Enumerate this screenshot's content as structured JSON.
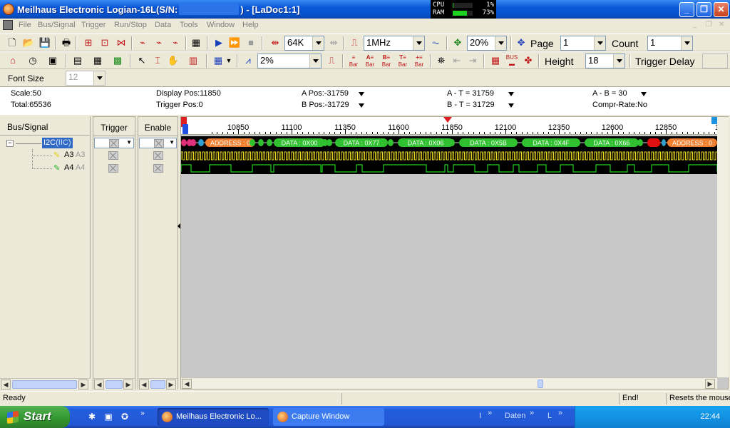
{
  "window": {
    "title_prefix": "Meilhaus Electronic Logian-16L(S/N:",
    "title_suffix": ") - [LaDoc1:1]"
  },
  "cpu_monitor": {
    "cpu_label": "CPU",
    "cpu_value": "1%",
    "cpu_fraction": 0.01,
    "ram_label": "RAM",
    "ram_value": "73%",
    "ram_fraction": 0.73
  },
  "menu": [
    "File",
    "Bus/Signal",
    "Trigger",
    "Run/Stop",
    "Data",
    "Tools",
    "Window",
    "Help"
  ],
  "toolbar1": {
    "memory_depth": "64K",
    "sample_rate": "1MHz",
    "trigger_pos": "20%",
    "page_label": "Page",
    "page_value": "1",
    "count_label": "Count",
    "count_value": "1"
  },
  "toolbar2": {
    "zoom": "2%",
    "bar_labels": [
      "Bar",
      "Bar",
      "Bar",
      "Bar",
      "Bar"
    ],
    "bus_label": "BUS",
    "height_label": "Height",
    "height_value": "18",
    "trigger_delay_label": "Trigger Delay"
  },
  "font_size": {
    "label": "Font Size",
    "value": "12"
  },
  "info": {
    "scale": "Scale:50",
    "total": "Total:65536",
    "display_pos": "Display Pos:11850",
    "trigger_pos": "Trigger Pos:0",
    "a_pos": "A Pos:-31759",
    "b_pos": "B Pos:-31729",
    "a_t": "A - T = 31759",
    "b_t": "B - T = 31729",
    "a_b": "A - B = 30",
    "compr_rate": "Compr-Rate:No"
  },
  "columns": {
    "bus_signal": "Bus/Signal",
    "trigger": "Trigger",
    "enable": "Enable"
  },
  "signals": [
    {
      "name": "I2C",
      "tag": "(IIC)",
      "type": "bus"
    },
    {
      "name": "A3",
      "alias": "A3",
      "color": "#f0e020"
    },
    {
      "name": "A4",
      "alias": "A4",
      "color": "#20d020"
    }
  ],
  "ruler_ticks": [
    "10850",
    "11100",
    "11350",
    "11600",
    "11850",
    "12100",
    "12350",
    "12600",
    "12850",
    "13"
  ],
  "bus_segments": [
    "ADDRESS : 0",
    "DATA : 0X00",
    "DATA : 0X77",
    "DATA : 0X06",
    "DATA : 0X5B",
    "DATA : 0X4F",
    "DATA : 0X66",
    "ADDRESS : 0"
  ],
  "status": {
    "ready": "Ready",
    "end": "End!",
    "hint": "Resets the mouse"
  },
  "taskbar": {
    "start": "Start",
    "tasks": [
      "Meilhaus Electronic Lo...",
      "Capture Window"
    ],
    "tray": [
      "I",
      "Daten",
      "L"
    ],
    "time": "22:44"
  },
  "colors": {
    "bus_address": "#f08030",
    "bus_data": "#30c030",
    "error": "#e01010",
    "titlebar": "#0a58d8"
  }
}
